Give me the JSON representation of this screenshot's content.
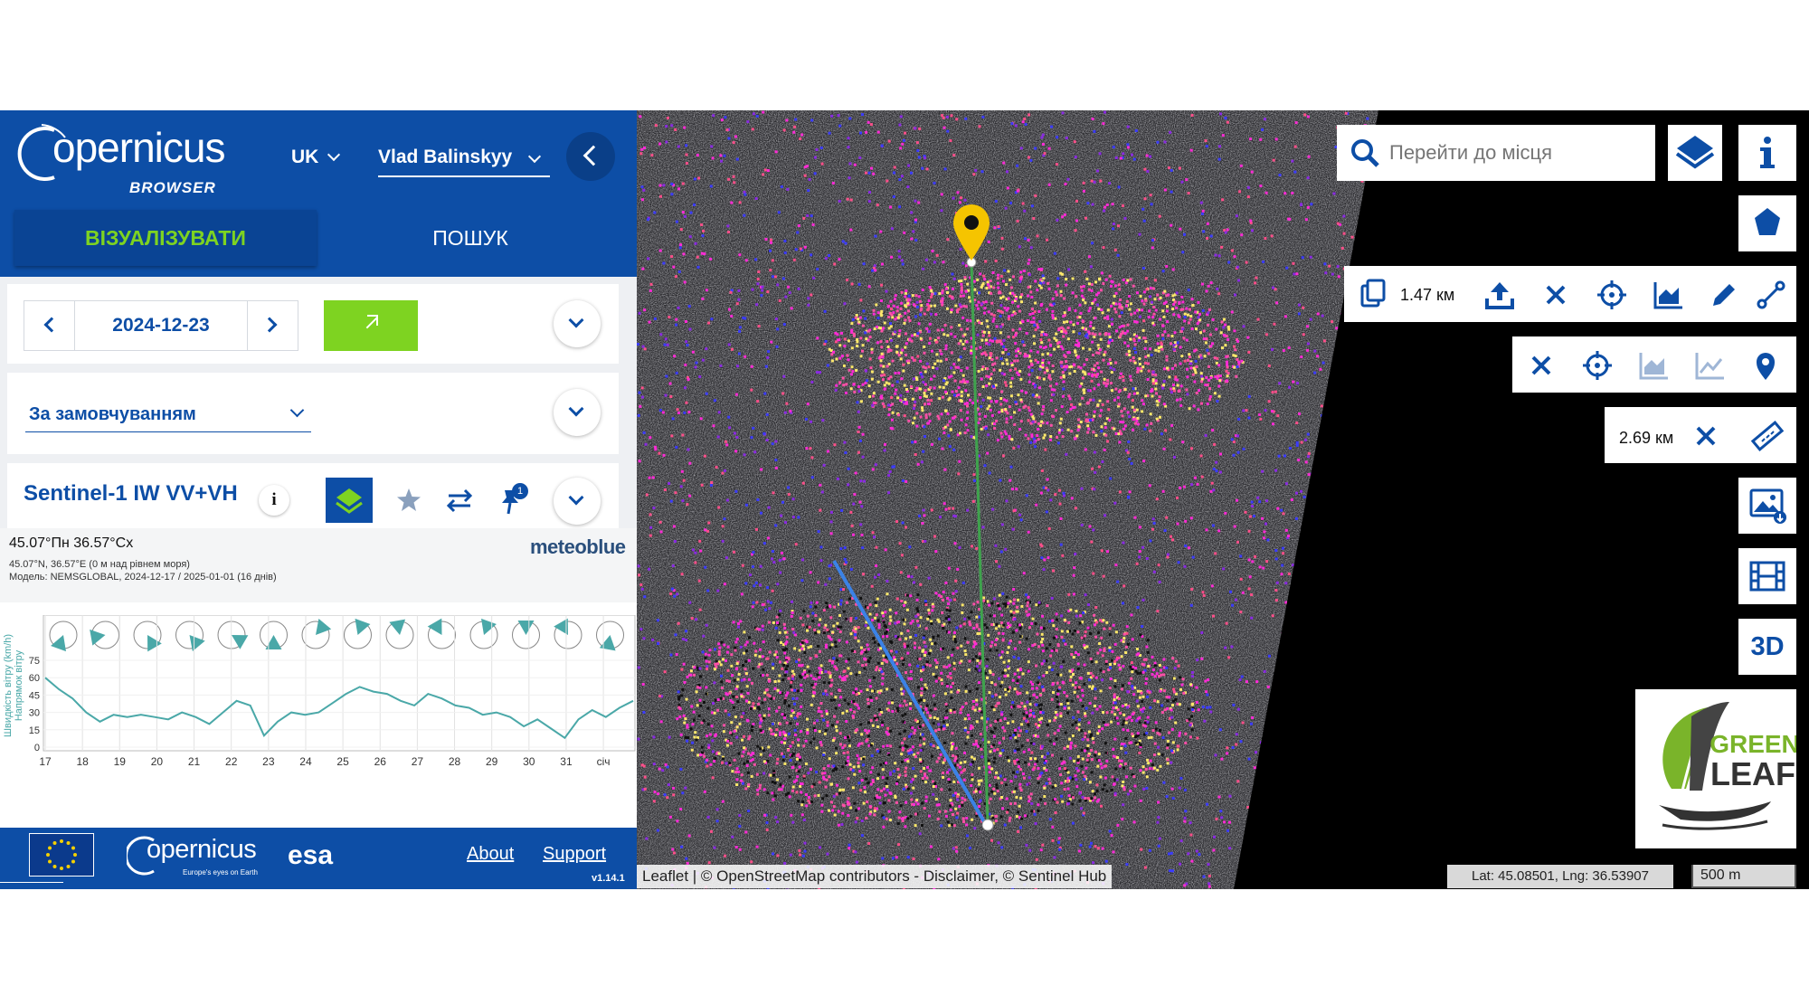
{
  "app": {
    "logo_text": "opernicus",
    "logo_sub": "BROWSER"
  },
  "header": {
    "language": "UK",
    "user": "Vlad Balinskyy",
    "tabs": [
      {
        "label": "ВІЗУАЛІЗУВАТИ",
        "active": true
      },
      {
        "label": "ПОШУК",
        "active": false
      }
    ]
  },
  "date_picker": {
    "date": "2024-12-23"
  },
  "theme": {
    "selected": "За замовчуванням"
  },
  "layer": {
    "name": "Sentinel-1 IW VV+VH",
    "info_label": "i",
    "pin_count": "1"
  },
  "weather": {
    "coords": "45.07°Пн 36.57°Сх",
    "coords_detail": "45.07°N, 36.57°E (0 м над рівнем моря)",
    "model": "Модель: NEMSGLOBAL, 2024-12-17 / 2025-01-01 (16 днів)",
    "brand": "meteoblue",
    "y_label_1": "Швидкість вітру (km/h)",
    "y_label_2": "Напрямок вітру",
    "y_ticks": [
      "75",
      "60",
      "45",
      "30",
      "15",
      "0"
    ],
    "x_ticks": [
      "17",
      "18",
      "19",
      "20",
      "21",
      "22",
      "23",
      "24",
      "25",
      "26",
      "27",
      "28",
      "29",
      "30",
      "31",
      "січ"
    ],
    "line_color": "#4aa8a8"
  },
  "chart_data": {
    "type": "line",
    "xlabel": "",
    "ylabel": "Швидкість вітру (km/h)",
    "ylim": [
      0,
      75
    ],
    "categories": [
      "17",
      "18",
      "19",
      "20",
      "21",
      "22",
      "23",
      "24",
      "25",
      "26",
      "27",
      "28",
      "29",
      "30",
      "31",
      "січ"
    ],
    "series": [
      {
        "values": [
          60,
          50,
          42,
          30,
          22,
          28,
          26,
          28,
          26,
          24,
          30,
          26,
          20,
          30,
          40,
          36,
          10,
          22,
          30,
          28,
          30,
          38,
          46,
          52,
          48,
          46,
          40,
          36,
          46,
          42,
          36,
          34,
          28,
          30,
          26,
          18,
          24,
          16,
          8,
          24,
          32,
          26,
          34,
          40
        ]
      }
    ]
  },
  "footer": {
    "about": "About",
    "support": "Support",
    "version": "v1.14.1",
    "copernicus": "opernicus",
    "copernicus_sub": "Europe's eyes on Earth",
    "esa": "esa"
  },
  "map": {
    "search_placeholder": "Перейти до місця",
    "measure_area": "1.47 км",
    "measure_distance": "2.69 км",
    "btn_3d": "3D",
    "attribution": "Leaflet | © OpenStreetMap contributors - Disclaimer, © Sentinel Hub",
    "coordinates": "Lat: 45.08501, Lng: 36.53907",
    "scale": "500 m",
    "logo_text_1": "GREEN",
    "logo_text_2": "LEAF",
    "accent_green": "#7ed321",
    "brand_blue": "#0d4ea6",
    "pin_color": "#f5c400",
    "line_green": "#3fa34d",
    "line_blue": "#3b82e6"
  }
}
